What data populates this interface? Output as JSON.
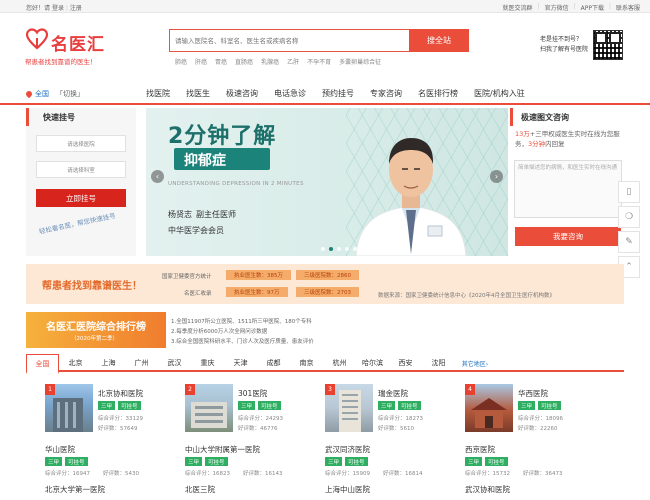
{
  "topbar": {
    "greeting": "您好！请",
    "login": "登录",
    "register": "注册",
    "links": [
      "就医交流群",
      "官方微信",
      "APP下载",
      "联系客服"
    ]
  },
  "header": {
    "logo_text": "名医汇",
    "slogan": "帮患者找到靠谱的医生！",
    "search_placeholder": "请输入医院名、科室名、医生名或疾病名称",
    "search_button": "搜全站",
    "hot_words": [
      "肺癌",
      "肝癌",
      "胃癌",
      "直肠癌",
      "乳腺癌",
      "乙肝",
      "不孕不育",
      "多囊卵巢综合征"
    ],
    "qr_line1": "老是挂不到号？",
    "qr_line2": "扫我了解有号医院"
  },
  "nav": {
    "city": "全国",
    "city_switch": "「切换」",
    "items": [
      "找医院",
      "找医生",
      "极速咨询",
      "电话急诊",
      "预约挂号",
      "专家咨询",
      "名医排行榜",
      "医院/机构入驻"
    ]
  },
  "booking": {
    "title": "快速挂号",
    "select_hospital": "请选择医院",
    "select_dept": "请选择科室",
    "button": "立即挂号",
    "slogan": "轻松看名医，帮您快速挂号"
  },
  "banner": {
    "title": "2分钟了解",
    "topic": "抑郁症",
    "subtitle_en": "UNDERSTANDING DEPRESSION IN 2 MINUTES",
    "doctor_name": "杨贤志",
    "doctor_title": "副主任医师",
    "org": "中华医学会会员",
    "prev": "‹",
    "next": "›",
    "slide_count": 5,
    "active_slide": 1
  },
  "consult": {
    "title": "极速图文咨询",
    "desc_highlight1": "13万",
    "desc_mid": "+三甲权威医生实时在线为您服务，",
    "desc_highlight2": "3分钟",
    "desc_end": "内回复",
    "textarea_placeholder": "简单描述您的病情，和医生实时在线沟通",
    "button": "我要咨询"
  },
  "float_tools": [
    {
      "icon": "mobile-icon",
      "glyph": "▯"
    },
    {
      "icon": "chat-icon",
      "glyph": "❍"
    },
    {
      "icon": "feedback-icon",
      "glyph": "✎"
    },
    {
      "icon": "back-to-top-icon",
      "glyph": "⌃"
    }
  ],
  "stats": {
    "slogan": "帮患者找到靠谱医生！",
    "row1_label": "国家卫健委官方统计",
    "licensed_doctors": "执业医生数：385万",
    "tertiary_hospitals": "三级医院数：2860",
    "row2_label": "名医汇收录",
    "included_doctors": "执业医生数：97万",
    "included_hospitals": "三级医院数：2703",
    "source": "数据来源：国家卫健委统计信息中心《2020年4月全国卫生医疗机构数》"
  },
  "ranking": {
    "title": "名医汇医院综合排行榜",
    "year": "（2020年第二季）",
    "notes": [
      "1.全国11907所公立医院、1511所三甲医院、180个专科",
      "2.每季度分析6000万人次全网问诊数据",
      "3.综合全国医院科研水平、门诊人次及医疗质量、患友评价"
    ],
    "tabs": [
      "全国",
      "北京",
      "上海",
      "广州",
      "武汉",
      "重庆",
      "天津",
      "成都",
      "南京",
      "杭州",
      "哈尔滨",
      "西安",
      "沈阳"
    ],
    "more": "其它地区›",
    "top_hospitals": [
      {
        "rank": "1",
        "name": "北京协和医院",
        "tag1": "三甲",
        "tag2": "可挂号",
        "score": "综合评分：33129",
        "reviews": "好评数：57649"
      },
      {
        "rank": "2",
        "name": "301医院",
        "tag1": "三甲",
        "tag2": "可挂号",
        "score": "综合评分：24293",
        "reviews": "好评数：46776"
      },
      {
        "rank": "3",
        "name": "瑞金医院",
        "tag1": "三甲",
        "tag2": "可挂号",
        "score": "综合评分：18273",
        "reviews": "好评数：5610"
      },
      {
        "rank": "4",
        "name": "华西医院",
        "tag1": "三甲",
        "tag2": "可挂号",
        "score": "综合评分：18096",
        "reviews": "好评数：22260"
      }
    ],
    "more_hospitals": [
      {
        "name": "华山医院",
        "tag1": "三甲",
        "tag2": "可挂号",
        "score": "综合评分：16947",
        "reviews": "好评数：5430"
      },
      {
        "name": "中山大学附属第一医院",
        "tag1": "三甲",
        "tag2": "可挂号",
        "score": "综合评分：16823",
        "reviews": "好评数：16143"
      },
      {
        "name": "武汉同济医院",
        "tag1": "三甲",
        "tag2": "可挂号",
        "score": "综合评分：15909",
        "reviews": "好评数：16814"
      },
      {
        "name": "西京医院",
        "tag1": "三甲",
        "tag2": "可挂号",
        "score": "综合评分：15732",
        "reviews": "好评数：36473"
      }
    ],
    "third_row": [
      "北京大学第一医院",
      "北医三院",
      "上海中山医院",
      "武汉协和医院"
    ]
  },
  "colors": {
    "brand": "#ea4e3a",
    "link": "#1a6fc2",
    "tag_green": "#2eae61",
    "banner_teal": "#1c837b"
  }
}
